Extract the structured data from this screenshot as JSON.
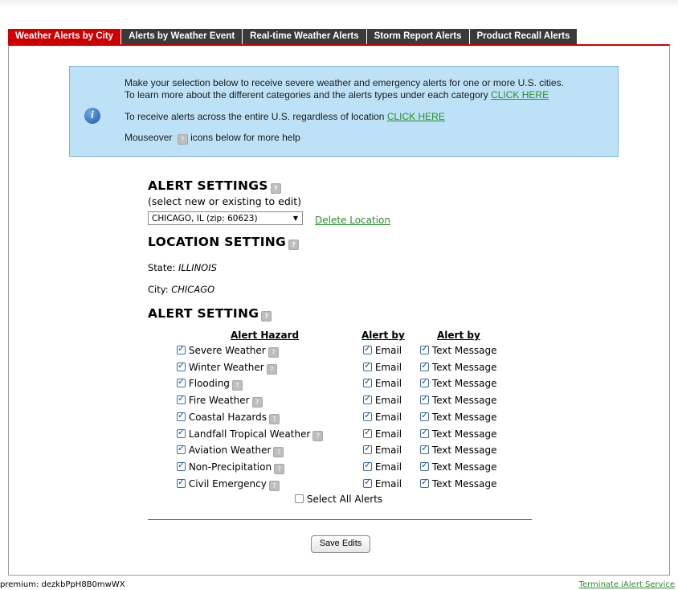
{
  "tabs": [
    {
      "label": "Weather Alerts by City"
    },
    {
      "label": "Alerts by Weather Event"
    },
    {
      "label": "Real-time Weather Alerts"
    },
    {
      "label": "Storm Report Alerts"
    },
    {
      "label": "Product Recall Alerts"
    }
  ],
  "info": {
    "line1": "Make your selection below to receive severe weather and emergency alerts for one or more U.S. cities.",
    "line2": "To learn more about the different categories and the alerts types under each category",
    "link1": "CLICK HERE",
    "line3": "To receive alerts across the entire U.S. regardless of location",
    "link2": "CLICK HERE",
    "line4a": "Mouseover",
    "line4b": "icons below for more help",
    "icon": "info-icon",
    "help_glyph": "?"
  },
  "alert_settings": {
    "title": "ALERT SETTINGS",
    "subtitle": "(select new or existing to edit)",
    "selected_location": "CHICAGO, IL (zip: 60623)",
    "delete_label": "Delete Location"
  },
  "location_setting": {
    "title": "LOCATION SETTING",
    "state_label": "State:",
    "state_value": "ILLINOIS",
    "city_label": "City:",
    "city_value": "CHICAGO"
  },
  "alert_setting": {
    "title": "ALERT SETTING",
    "col_hazard": "Alert Hazard",
    "col_alert_by_1": "Alert by",
    "col_alert_by_2": "Alert by",
    "email_label": "Email",
    "text_label": "Text Message",
    "hazards": [
      {
        "label": "Severe Weather",
        "checked": true
      },
      {
        "label": "Winter Weather",
        "checked": true
      },
      {
        "label": "Flooding",
        "checked": true
      },
      {
        "label": "Fire Weather",
        "checked": true
      },
      {
        "label": "Coastal Hazards",
        "checked": true
      },
      {
        "label": "Landfall Tropical Weather",
        "checked": true
      },
      {
        "label": "Aviation Weather",
        "checked": true
      },
      {
        "label": "Non-Precipitation",
        "checked": true
      },
      {
        "label": "Civil Emergency",
        "checked": true
      }
    ],
    "select_all_label": "Select All Alerts",
    "select_all_checked": false
  },
  "save_label": "Save Edits",
  "footer": {
    "premium": "premium: dezkbPpH8B0mwWX",
    "terminate": "Terminate iAlert Service"
  },
  "colors": {
    "active_tab": "#cc0000",
    "tab": "#3a3a3a",
    "info_bg": "#bde2f7",
    "link": "#2a8c2a"
  }
}
